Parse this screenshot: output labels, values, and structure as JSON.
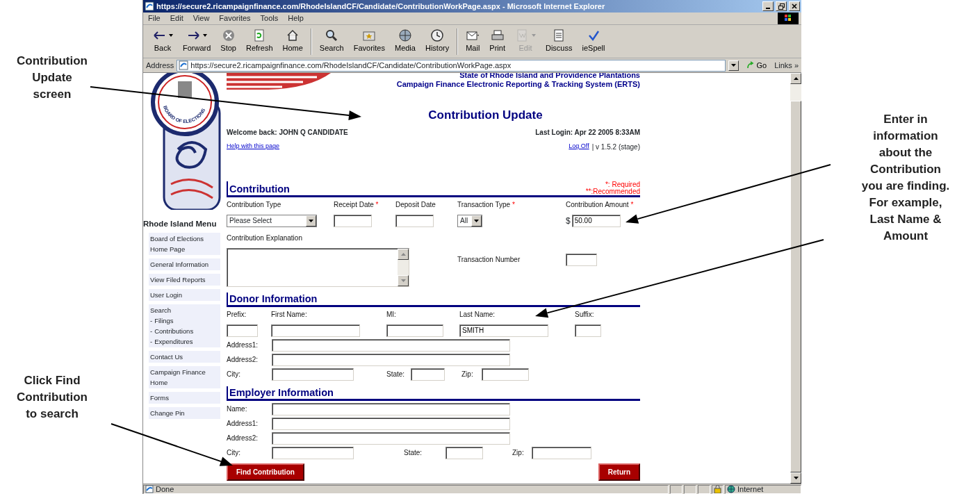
{
  "annotations": [
    {
      "text": "Contribution\nUpdate\nscreen"
    },
    {
      "text": "Click Find\nContribution\nto search"
    },
    {
      "text": "Enter in\ninformation\nabout the\nContribution\nyou are finding.\nFor example,\nLast Name &\nAmount"
    }
  ],
  "window": {
    "title": "https://secure2.ricampaignfinance.com/RhodeIslandCF/Candidate/ContributionWorkPage.aspx - Microsoft Internet Explorer",
    "menu": [
      "File",
      "Edit",
      "View",
      "Favorites",
      "Tools",
      "Help"
    ],
    "toolbar": [
      {
        "label": "Back",
        "dropdown": true,
        "disabled": false
      },
      {
        "label": "Forward",
        "dropdown": true,
        "disabled": false
      },
      {
        "label": "Stop",
        "dropdown": false,
        "disabled": false
      },
      {
        "label": "Refresh",
        "dropdown": false,
        "disabled": false
      },
      {
        "label": "Home",
        "dropdown": false,
        "disabled": false
      },
      {
        "label": "Search",
        "dropdown": false,
        "disabled": false
      },
      {
        "label": "Favorites",
        "dropdown": false,
        "disabled": false
      },
      {
        "label": "Media",
        "dropdown": false,
        "disabled": false
      },
      {
        "label": "History",
        "dropdown": false,
        "disabled": false
      },
      {
        "label": "Mail",
        "dropdown": false,
        "disabled": false
      },
      {
        "label": "Print",
        "dropdown": false,
        "disabled": false
      },
      {
        "label": "Edit",
        "dropdown": true,
        "disabled": true
      },
      {
        "label": "Discuss",
        "dropdown": false,
        "disabled": false
      },
      {
        "label": "ieSpell",
        "dropdown": false,
        "disabled": false
      }
    ],
    "address": {
      "label": "Address",
      "url": "https://secure2.ricampaignfinance.com/RhodeIslandCF/Candidate/ContributionWorkPage.aspx",
      "go": "Go",
      "links": "Links »"
    }
  },
  "page": {
    "state_line": "State of Rhode Island and Providence Plantations",
    "system": "Campaign Finance Electronic Reporting & Tracking System (ERTS)",
    "logo_text": "BOARD OF ELECTIONS",
    "title": "Contribution Update",
    "welcome": "Welcome back: JOHN Q CANDIDATE",
    "last_login": "Last Login: Apr 22 2005 8:33AM",
    "help_link": "Help with this page",
    "log_off": "Log Off",
    "version": "| v 1.5.2 (stage)",
    "legend": [
      "*: Required",
      "**:Recommended"
    ],
    "menu_title": "Rhode Island Menu",
    "menu": [
      {
        "label": "Board of Elections Home Page"
      },
      {
        "label": "General Information"
      },
      {
        "label": "View Filed Reports"
      },
      {
        "label": "User Login"
      },
      {
        "label": "Search",
        "children": [
          {
            "marker": "-",
            "label": "Filings"
          },
          {
            "marker": "-",
            "label": "Contributions"
          },
          {
            "marker": "-",
            "label": "Expenditures"
          }
        ]
      },
      {
        "label": "Contact Us"
      },
      {
        "label": "Campaign Finance Home"
      },
      {
        "label": "Forms"
      },
      {
        "label": "Change Pin"
      }
    ],
    "sections": [
      {
        "title": "Contribution",
        "rows": [
          {
            "kind": "stacked",
            "fields": [
              {
                "kind": "select",
                "label": "Contribution Type",
                "value": "Please Select"
              },
              {
                "kind": "text",
                "label": "Receipt Date",
                "required_mark": "*"
              },
              {
                "kind": "text",
                "label": "Deposit Date"
              },
              {
                "kind": "select",
                "label": "Transaction Type",
                "required_mark": "*",
                "value": "All"
              },
              {
                "kind": "text",
                "label": "Contribution Amount",
                "required_mark": "*",
                "prefix": "$",
                "value": "50.00"
              }
            ]
          },
          {
            "kind": "inline",
            "fields": [
              {
                "kind": "textarea",
                "label": "Contribution Explanation"
              },
              {
                "kind": "text",
                "label": "Transaction Number"
              }
            ]
          }
        ]
      },
      {
        "title": "Donor Information",
        "rows": [
          {
            "kind": "stacked",
            "fields": [
              {
                "kind": "text",
                "label": "Prefix:"
              },
              {
                "kind": "text",
                "label": "First Name:"
              },
              {
                "kind": "text",
                "label": "MI:"
              },
              {
                "kind": "text",
                "label": "Last Name:",
                "value": "SMITH"
              },
              {
                "kind": "text",
                "label": "Suffix:"
              }
            ]
          },
          {
            "kind": "inline",
            "fields": [
              {
                "kind": "text",
                "label": "Address1:"
              }
            ]
          },
          {
            "kind": "inline",
            "fields": [
              {
                "kind": "text",
                "label": "Address2:"
              }
            ]
          },
          {
            "kind": "inline",
            "fields": [
              {
                "kind": "text",
                "label": "City:"
              },
              {
                "kind": "text",
                "label": "State:"
              },
              {
                "kind": "text",
                "label": "Zip:"
              }
            ]
          }
        ]
      },
      {
        "title": "Employer Information",
        "rows": [
          {
            "kind": "inline",
            "fields": [
              {
                "kind": "text",
                "label": "Name:"
              }
            ]
          },
          {
            "kind": "inline",
            "fields": [
              {
                "kind": "text",
                "label": "Address1:"
              }
            ]
          },
          {
            "kind": "inline",
            "fields": [
              {
                "kind": "text",
                "label": "Address2:"
              }
            ]
          },
          {
            "kind": "inline",
            "fields": [
              {
                "kind": "text",
                "label": "City:"
              },
              {
                "kind": "text",
                "label": "State:"
              },
              {
                "kind": "text",
                "label": "Zip:"
              }
            ]
          }
        ]
      }
    ],
    "buttons": [
      {
        "label": "Find Contribution"
      },
      {
        "label": "Return"
      }
    ]
  },
  "status_bar": {
    "text": "Done",
    "zone": "Internet"
  }
}
